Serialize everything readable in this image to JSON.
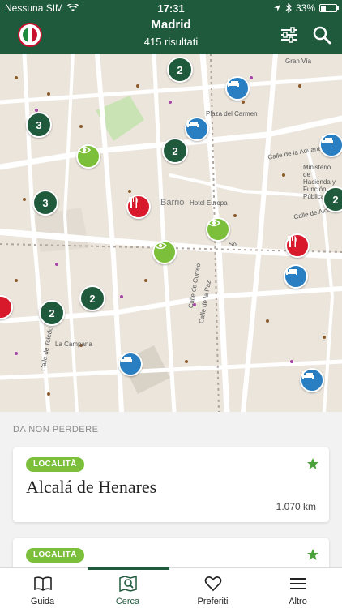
{
  "status_bar": {
    "carrier": "Nessuna SIM",
    "time": "17:31",
    "battery_text": "33%",
    "battery_level": 0.33
  },
  "header": {
    "title": "Madrid",
    "subtitle": "415 risultati",
    "logo_icon": "madrid-guide-logo",
    "filter_icon": "filter-sliders-icon",
    "search_icon": "search-icon",
    "color": "#1f5a3c"
  },
  "map": {
    "street_labels": [
      "Plaza del Carmen",
      "Calle de la Aduana",
      "Calle de Alcalá",
      "Gran Vía",
      "Barrio",
      "Sol",
      "Calle de Correo",
      "Calle de la Paz",
      "Calle de Toledo",
      "Hotel Europa",
      "Ministerio de Hacienda y Función Pública",
      "La Campana"
    ],
    "clusters": [
      "2",
      "3",
      "2",
      "3",
      "2",
      "2",
      "2"
    ],
    "colors": {
      "cluster": "#1f5a3c",
      "hotel": "#2a7fc2",
      "eat": "#d7192b",
      "see": "#7cbf3a"
    }
  },
  "list": {
    "section_title": "DA NON PERDERE",
    "cards": [
      {
        "badge": "LOCALITÀ",
        "title": "Alcalá de Henares",
        "distance": "1.070 km"
      },
      {
        "badge": "LOCALITÀ",
        "title": "",
        "distance": ""
      }
    ]
  },
  "tabbar": {
    "tabs": [
      {
        "label": "Guida",
        "icon": "book-icon"
      },
      {
        "label": "Cerca",
        "icon": "map-search-icon"
      },
      {
        "label": "Preferiti",
        "icon": "heart-icon"
      },
      {
        "label": "Altro",
        "icon": "menu-icon"
      }
    ],
    "active": "Cerca"
  }
}
